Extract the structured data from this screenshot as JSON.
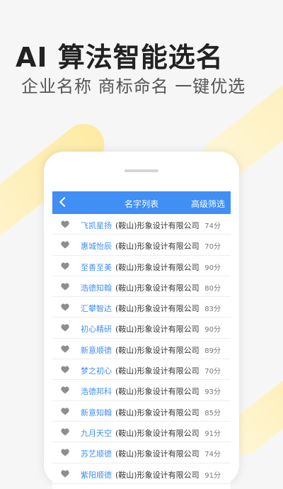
{
  "promo": {
    "headline": "AI 算法智能选名",
    "subline": "企业名称 商标命名 一键优选"
  },
  "colors": {
    "accent": "#3f8ff5",
    "stripe": "#ffe99a"
  },
  "navbar": {
    "back_icon": "chevron-left-icon",
    "title": "名字列表",
    "filter_label": "高级筛选"
  },
  "list": {
    "suffix": "(鞍山)形象设计有限公司",
    "items": [
      {
        "name": "飞凯星扬",
        "score": "74分"
      },
      {
        "name": "惠城怡辰",
        "score": "70分"
      },
      {
        "name": "至善至美",
        "score": "90分"
      },
      {
        "name": "浩德知翰",
        "score": "80分"
      },
      {
        "name": "汇攀智达",
        "score": "83分"
      },
      {
        "name": "初心精研",
        "score": "90分"
      },
      {
        "name": "新意顺德",
        "score": "89分"
      },
      {
        "name": "梦之初心",
        "score": "70分"
      },
      {
        "name": "浩德邦科",
        "score": "93分"
      },
      {
        "name": "新意知翰",
        "score": "85分"
      },
      {
        "name": "九月天空",
        "score": "91分"
      },
      {
        "name": "苏艺顺德",
        "score": "74分"
      },
      {
        "name": "紫阳顺德",
        "score": "91分"
      }
    ]
  }
}
